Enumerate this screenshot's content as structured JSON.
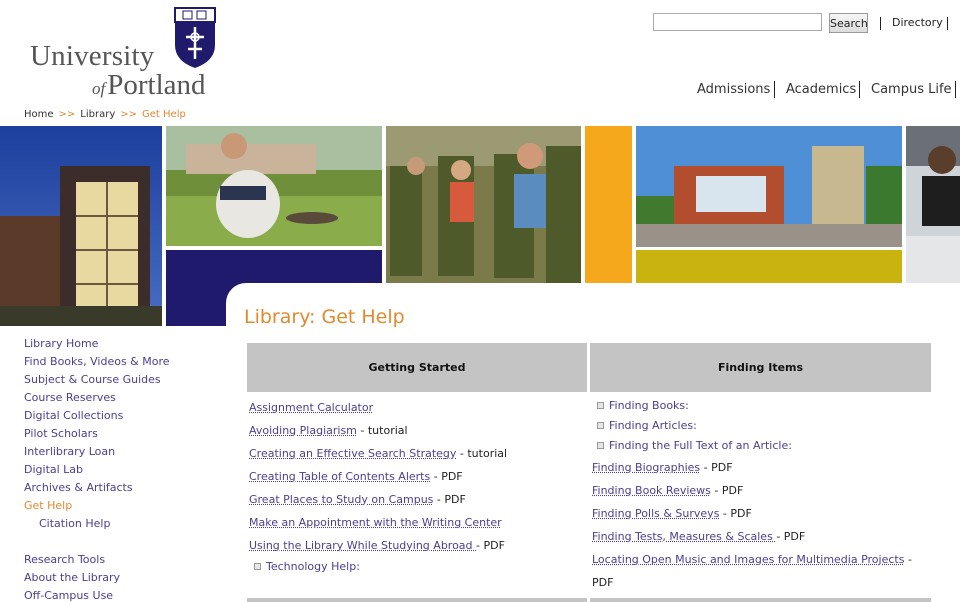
{
  "header": {
    "logo": {
      "line1": "University",
      "of": "of",
      "line2": "Portland",
      "seal_alt": "University of Portland seal"
    },
    "search": {
      "placeholder": "",
      "button": "Search"
    },
    "directory": "Directory",
    "nav": [
      "Admissions",
      "Academics",
      "Campus Life"
    ]
  },
  "breadcrumb": {
    "home": "Home",
    "sep": ">>",
    "library": "Library",
    "current": "Get Help"
  },
  "page_title": "Library: Get Help",
  "sidebar": {
    "items": [
      {
        "label": "Library Home"
      },
      {
        "label": "Find Books, Videos & More"
      },
      {
        "label": "Subject & Course Guides"
      },
      {
        "label": "Course Reserves"
      },
      {
        "label": "Digital Collections"
      },
      {
        "label": "Pilot Scholars"
      },
      {
        "label": "Interlibrary Loan"
      },
      {
        "label": "Digital Lab"
      },
      {
        "label": "Archives & Artifacts"
      },
      {
        "label": "Get Help"
      },
      {
        "label": "Citation Help"
      },
      {
        "label": "Research Tools"
      },
      {
        "label": "About the Library"
      },
      {
        "label": "Off-Campus Use"
      }
    ]
  },
  "table": {
    "col1_header": "Getting Started",
    "col2_header": "Finding Items",
    "col1": [
      {
        "link": "Assignment Calculator",
        "suffix": ""
      },
      {
        "link": "Avoiding Plagiarism",
        "suffix": " - tutorial"
      },
      {
        "link": "Creating an Effective Search Strategy",
        "suffix": " - tutorial"
      },
      {
        "link": "Creating Table of Contents Alerts",
        "suffix": " - PDF"
      },
      {
        "link": "Great Places to Study on Campus",
        "suffix": " - PDF"
      },
      {
        "link": "Make an Appointment with the Writing Center",
        "suffix": ""
      },
      {
        "link": "Using the Library While Studying Abroad ",
        "suffix": "- PDF"
      }
    ],
    "col1_expand": "Technology Help:",
    "col2_expand": [
      "Finding Books:",
      "Finding Articles:",
      "Finding the Full Text of an Article:"
    ],
    "col2": [
      {
        "link": "Finding Biographies",
        "suffix": " - PDF"
      },
      {
        "link": "Finding Book Reviews",
        "suffix": " - PDF"
      },
      {
        "link": "Finding Polls & Surveys",
        "suffix": " - PDF"
      },
      {
        "link": "Finding Tests, Measures & Scales ",
        "suffix": "- PDF"
      },
      {
        "link": "Locating Open Music and Images for Multimedia Projects",
        "suffix": " -"
      }
    ],
    "col2_wrap": "PDF"
  },
  "colors": {
    "accent_orange": "#e08a2e",
    "link_purple": "#4a3f8f",
    "navy": "#1f1a6b",
    "gold": "#f5a81c",
    "olive": "#c9b40f"
  }
}
